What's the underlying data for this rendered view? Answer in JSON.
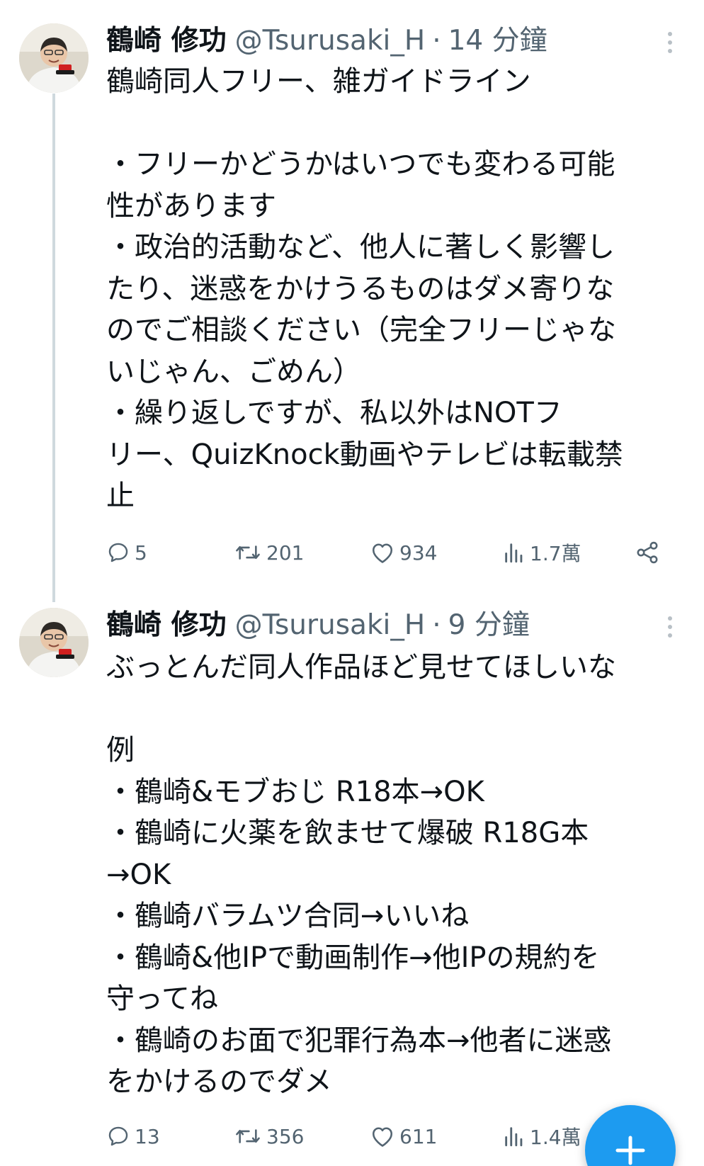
{
  "tweets": [
    {
      "author": {
        "display_name": "鶴崎 修功",
        "handle": "@Tsurusaki_H",
        "avatar_icon": "avatar-photo"
      },
      "separator": "·",
      "time": "14 分鐘",
      "lines": [
        "鶴崎同人フリー、雑ガイドライン",
        "",
        "・フリーかどうかはいつでも変わる可能",
        "性があります",
        "・政治的活動など、他人に著しく影響し",
        "たり、迷惑をかけうるものはダメ寄りな",
        "のでご相談ください（完全フリーじゃな",
        "いじゃん、ごめん）",
        "・繰り返しですが、私以外はNOTフ",
        "リー、QuizKnock動画やテレビは転載禁",
        "止"
      ],
      "stats": {
        "replies": "5",
        "retweets": "201",
        "likes": "934",
        "views": "1.7萬"
      }
    },
    {
      "author": {
        "display_name": "鶴崎 修功",
        "handle": "@Tsurusaki_H",
        "avatar_icon": "avatar-photo"
      },
      "separator": "·",
      "time": "9 分鐘",
      "lines": [
        "ぶっとんだ同人作品ほど見せてほしいな",
        "",
        "例",
        "・鶴崎&モブおじ R18本→OK",
        "・鶴崎に火薬を飲ませて爆破 R18G本",
        "→OK",
        "・鶴崎バラムツ合同→いいね",
        "・鶴崎&他IPで動画制作→他IPの規約を",
        "守ってね",
        "・鶴崎のお面で犯罪行為本→他者に迷惑",
        "をかけるのでダメ"
      ],
      "stats": {
        "replies": "13",
        "retweets": "356",
        "likes": "611",
        "views": "1.4萬"
      }
    }
  ],
  "icons": {
    "more": "more-vertical-icon",
    "reply": "reply-icon",
    "retweet": "retweet-icon",
    "like": "heart-icon",
    "views": "views-icon",
    "share": "share-icon",
    "compose": "plus-icon"
  },
  "colors": {
    "text": "#0f1419",
    "muted": "#536471",
    "accent": "#1d9bf0",
    "thread_line": "#cfd9de",
    "background": "#ffffff"
  }
}
